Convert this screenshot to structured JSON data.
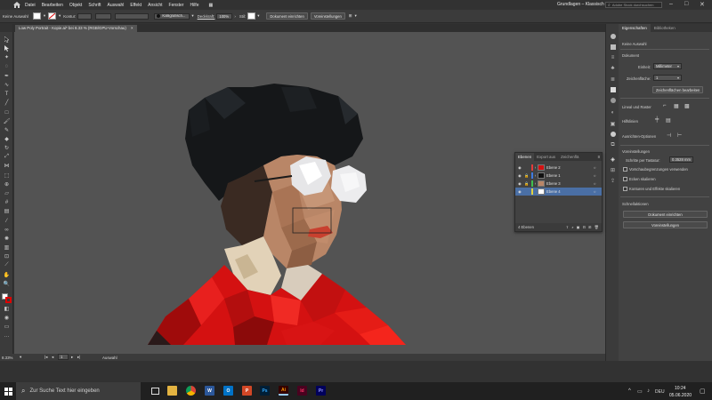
{
  "menubar": {
    "items": [
      "Datei",
      "Bearbeiten",
      "Objekt",
      "Schrift",
      "Auswahl",
      "Effekt",
      "Ansicht",
      "Fenster",
      "Hilfe"
    ],
    "workspace": "Grundlagen – Klassisch",
    "search_placeholder": "Adobe Stock durchsuchen"
  },
  "controlbar": {
    "selection_label": "Keine Auswahl",
    "stroke_label": "Kontur:",
    "brush_label": "Kalligrafisch...",
    "opacity_label": "Deckkraft:",
    "opacity_value": "100%",
    "style_label": "Stil:",
    "doc_setup_button": "Dokument einrichten",
    "prefs_button": "Voreinstellungen"
  },
  "document_tab": {
    "title": "Low Poly Portrait - Kopie.ai* bei 8.33 % (RGB/GPU-Vorschau)"
  },
  "statusbar": {
    "zoom": "8.33%",
    "page": "1",
    "tool": "Auswahl"
  },
  "properties_panel": {
    "tab_active": "Eigenschaften",
    "tab_other": "Bibliotheken",
    "selection": "Keine Auswahl",
    "section_document": "Dokument",
    "unit_label": "Einheit:",
    "unit_value": "Millimeter",
    "artboard_label": "Zeichenfläche:",
    "artboard_value": "1",
    "edit_artboards_button": "Zeichenflächen bearbeiten",
    "rulers_grid": "Lineal und Raster",
    "guides": "Hilfslinien",
    "align_options": "Ausrichten-Optionen",
    "prefs_header": "Voreinstellungen",
    "keyboard_increment_label": "Schritte per Tastatur:",
    "keyboard_increment_value": "0.3528 mm",
    "check_preview_bounds": "Vorschaubegrenzungen verwenden",
    "check_scale_corners": "Ecken skalieren",
    "check_scale_strokes": "Konturen und Effekte skalieren",
    "quick_actions": "Schnellaktionen",
    "doc_setup_button": "Dokument einrichten",
    "prefs_button": "Voreinstellungen"
  },
  "layers_panel": {
    "tabs": [
      "Ebenen",
      "Export aus",
      "Zeichenflä"
    ],
    "rows": [
      {
        "name": "Ebene 2",
        "color": "#e33b3b"
      },
      {
        "name": "Ebene 1",
        "color": "#3f7be0"
      },
      {
        "name": "Ebene 3",
        "color": "#3fbf4f"
      },
      {
        "name": "Ebene 4",
        "color": "#e0d23f"
      }
    ],
    "footer_count": "4 Ebenen"
  },
  "taskbar": {
    "search_placeholder": "Zur Suche Text hier eingeben",
    "language": "DEU",
    "time": "10:24",
    "date": "05.06.2020"
  },
  "colors": {
    "canvas": "#535353",
    "shirt": "#d41111",
    "hair": "#141618",
    "highlight": "#4a6fa5"
  }
}
